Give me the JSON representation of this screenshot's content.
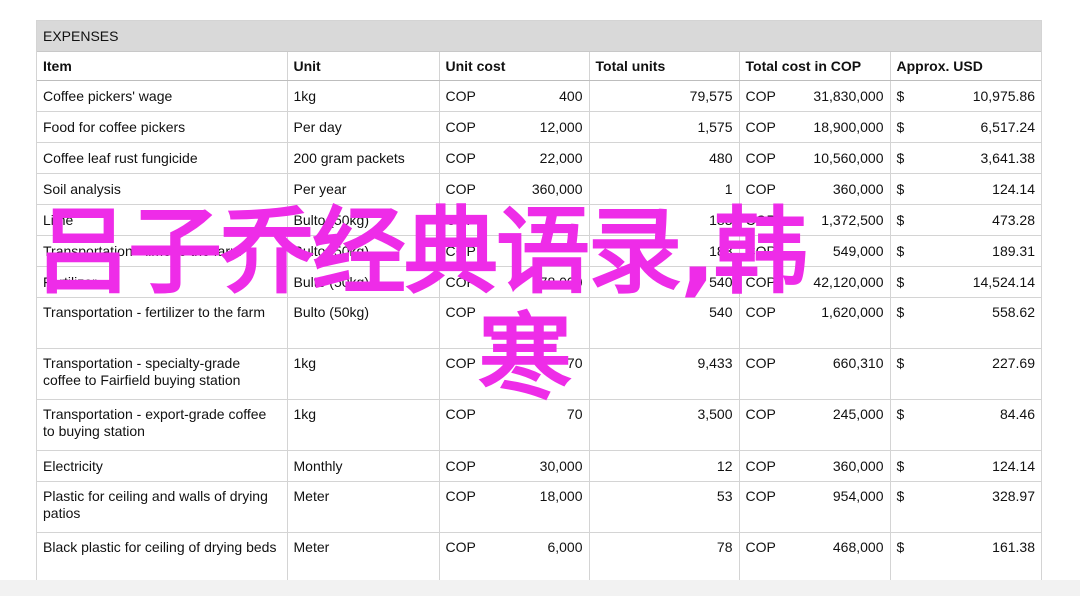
{
  "sheet_title": "EXPENSES",
  "headers": [
    "Item",
    "Unit",
    "Unit cost",
    "Total units",
    "Total cost in COP",
    "Approx. USD"
  ],
  "rows": [
    {
      "item": "Coffee pickers' wage",
      "unit": "1kg",
      "ucost_cur": "COP",
      "ucost": "400",
      "units": "79,575",
      "total_cur": "COP",
      "total": "31,830,000",
      "usd_cur": "$",
      "usd": "10,975.86"
    },
    {
      "item": "Food for coffee pickers",
      "unit": "Per day",
      "ucost_cur": "COP",
      "ucost": "12,000",
      "units": "1,575",
      "total_cur": "COP",
      "total": "18,900,000",
      "usd_cur": "$",
      "usd": "6,517.24"
    },
    {
      "item": "Coffee leaf rust fungicide",
      "unit": "200 gram packets",
      "ucost_cur": "COP",
      "ucost": "22,000",
      "units": "480",
      "total_cur": "COP",
      "total": "10,560,000",
      "usd_cur": "$",
      "usd": "3,641.38"
    },
    {
      "item": "Soil analysis",
      "unit": "Per year",
      "ucost_cur": "COP",
      "ucost": "360,000",
      "units": "1",
      "total_cur": "COP",
      "total": "360,000",
      "usd_cur": "$",
      "usd": "124.14"
    },
    {
      "item": "Lime",
      "unit": "Bulto (50kg)",
      "ucost_cur": "COP",
      "ucost": "",
      "units": "183",
      "total_cur": "COP",
      "total": "1,372,500",
      "usd_cur": "$",
      "usd": "473.28"
    },
    {
      "item": "Transportation - lime to the farm",
      "unit": "Bulto (50kg)",
      "ucost_cur": "COP",
      "ucost": "",
      "units": "183",
      "total_cur": "COP",
      "total": "549,000",
      "usd_cur": "$",
      "usd": "189.31"
    },
    {
      "item": "Fertilizer",
      "unit": "Bulto (50kg)",
      "ucost_cur": "COP",
      "ucost": "78,000",
      "units": "540",
      "total_cur": "COP",
      "total": "42,120,000",
      "usd_cur": "$",
      "usd": "14,524.14"
    },
    {
      "item": "Transportation - fertilizer to the farm",
      "unit": "Bulto (50kg)",
      "ucost_cur": "COP",
      "ucost": "",
      "units": "540",
      "total_cur": "COP",
      "total": "1,620,000",
      "usd_cur": "$",
      "usd": "558.62"
    },
    {
      "item": "Transportation - specialty-grade coffee to Fairfield buying station",
      "unit": "1kg",
      "ucost_cur": "COP",
      "ucost": "70",
      "units": "9,433",
      "total_cur": "COP",
      "total": "660,310",
      "usd_cur": "$",
      "usd": "227.69"
    },
    {
      "item": "Transportation - export-grade coffee to buying station",
      "unit": "1kg",
      "ucost_cur": "COP",
      "ucost": "70",
      "units": "3,500",
      "total_cur": "COP",
      "total": "245,000",
      "usd_cur": "$",
      "usd": "84.46"
    },
    {
      "item": "Electricity",
      "unit": "Monthly",
      "ucost_cur": "COP",
      "ucost": "30,000",
      "units": "12",
      "total_cur": "COP",
      "total": "360,000",
      "usd_cur": "$",
      "usd": "124.14"
    },
    {
      "item": "Plastic for ceiling and walls of drying patios",
      "unit": "Meter",
      "ucost_cur": "COP",
      "ucost": "18,000",
      "units": "53",
      "total_cur": "COP",
      "total": "954,000",
      "usd_cur": "$",
      "usd": "328.97"
    },
    {
      "item": "Black plastic for ceiling of drying beds",
      "unit": "Meter",
      "ucost_cur": "COP",
      "ucost": "6,000",
      "units": "78",
      "total_cur": "COP",
      "total": "468,000",
      "usd_cur": "$",
      "usd": "161.38"
    }
  ],
  "overlay": {
    "line1": "吕子乔经典语录,韩",
    "line2": "寒",
    "color": "#ee2ce8"
  }
}
